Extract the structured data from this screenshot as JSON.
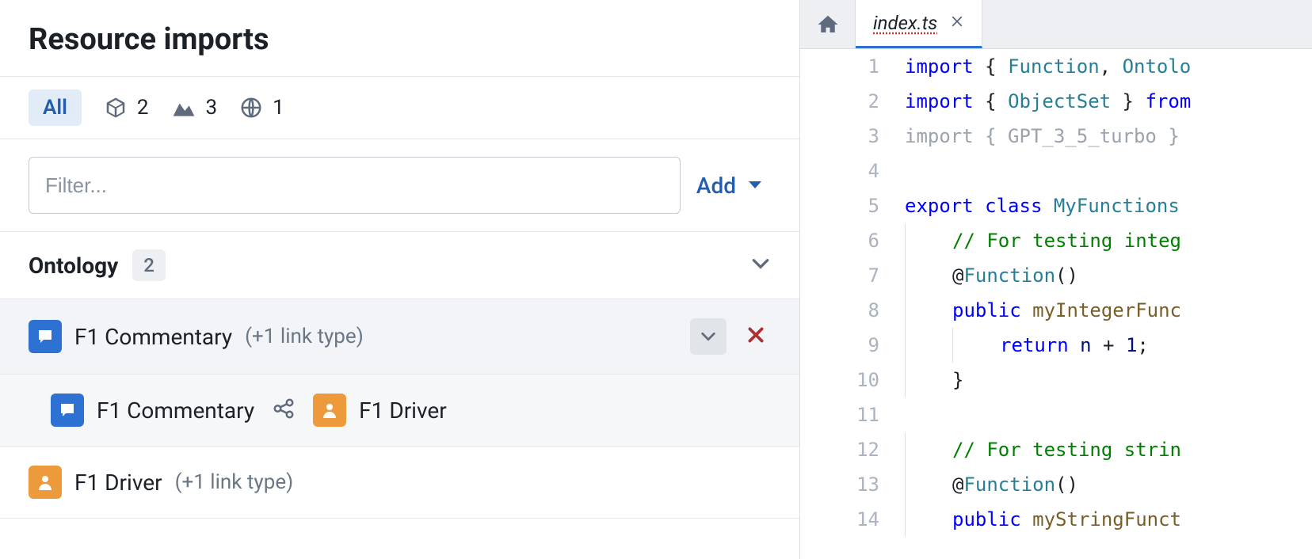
{
  "panel": {
    "title": "Resource imports",
    "tabs": {
      "all_label": "All",
      "cube_count": "2",
      "graph_count": "3",
      "globe_count": "1"
    },
    "filter_placeholder": "Filter...",
    "add_label": "Add"
  },
  "section": {
    "title": "Ontology",
    "count": "2"
  },
  "resources": [
    {
      "name": "F1 Commentary",
      "link_badge": "(+1 link type)",
      "icon_color": "blue",
      "expanded": true,
      "links": [
        {
          "from_name": "F1 Commentary",
          "from_icon": "blue",
          "to_name": "F1 Driver",
          "to_icon": "orange"
        }
      ]
    },
    {
      "name": "F1 Driver",
      "link_badge": "(+1 link type)",
      "icon_color": "orange",
      "expanded": false
    }
  ],
  "editor": {
    "filename": "index.ts",
    "lines": [
      {
        "n": 1,
        "tokens": [
          [
            "kw",
            "import"
          ],
          [
            "punct",
            " { "
          ],
          [
            "type",
            "Function"
          ],
          [
            "punct",
            ", "
          ],
          [
            "type",
            "Ontolo"
          ]
        ]
      },
      {
        "n": 2,
        "tokens": [
          [
            "kw",
            "import"
          ],
          [
            "punct",
            " { "
          ],
          [
            "type",
            "ObjectSet"
          ],
          [
            "punct",
            " } "
          ],
          [
            "kw",
            "from"
          ]
        ]
      },
      {
        "n": 3,
        "tokens": [
          [
            "unused",
            "import { GPT_3_5_turbo } "
          ]
        ]
      },
      {
        "n": 4,
        "tokens": []
      },
      {
        "n": 5,
        "tokens": [
          [
            "kw",
            "export"
          ],
          [
            "punct",
            " "
          ],
          [
            "kw",
            "class"
          ],
          [
            "punct",
            " "
          ],
          [
            "type",
            "MyFunctions"
          ],
          [
            "punct",
            " "
          ]
        ]
      },
      {
        "n": 6,
        "indent": 1,
        "tokens": [
          [
            "comment",
            "// For testing integ"
          ]
        ]
      },
      {
        "n": 7,
        "indent": 1,
        "tokens": [
          [
            "at",
            "@"
          ],
          [
            "dec",
            "Function"
          ],
          [
            "punct",
            "()"
          ]
        ]
      },
      {
        "n": 8,
        "indent": 1,
        "tokens": [
          [
            "kw",
            "public"
          ],
          [
            "punct",
            " "
          ],
          [
            "fn",
            "myIntegerFunc"
          ]
        ]
      },
      {
        "n": 9,
        "indent": 2,
        "tokens": [
          [
            "kw",
            "return"
          ],
          [
            "punct",
            " "
          ],
          [
            "id",
            "n"
          ],
          [
            "punct",
            " + "
          ],
          [
            "id",
            "1"
          ],
          [
            "punct",
            ";"
          ]
        ]
      },
      {
        "n": 10,
        "indent": 1,
        "tokens": [
          [
            "punct",
            "}"
          ]
        ]
      },
      {
        "n": 11,
        "indent": 0,
        "tokens": []
      },
      {
        "n": 12,
        "indent": 1,
        "tokens": [
          [
            "comment",
            "// For testing strin"
          ]
        ]
      },
      {
        "n": 13,
        "indent": 1,
        "tokens": [
          [
            "at",
            "@"
          ],
          [
            "dec",
            "Function"
          ],
          [
            "punct",
            "()"
          ]
        ]
      },
      {
        "n": 14,
        "indent": 1,
        "tokens": [
          [
            "kw",
            "public"
          ],
          [
            "punct",
            " "
          ],
          [
            "fn",
            "myStringFunct"
          ]
        ]
      }
    ]
  }
}
